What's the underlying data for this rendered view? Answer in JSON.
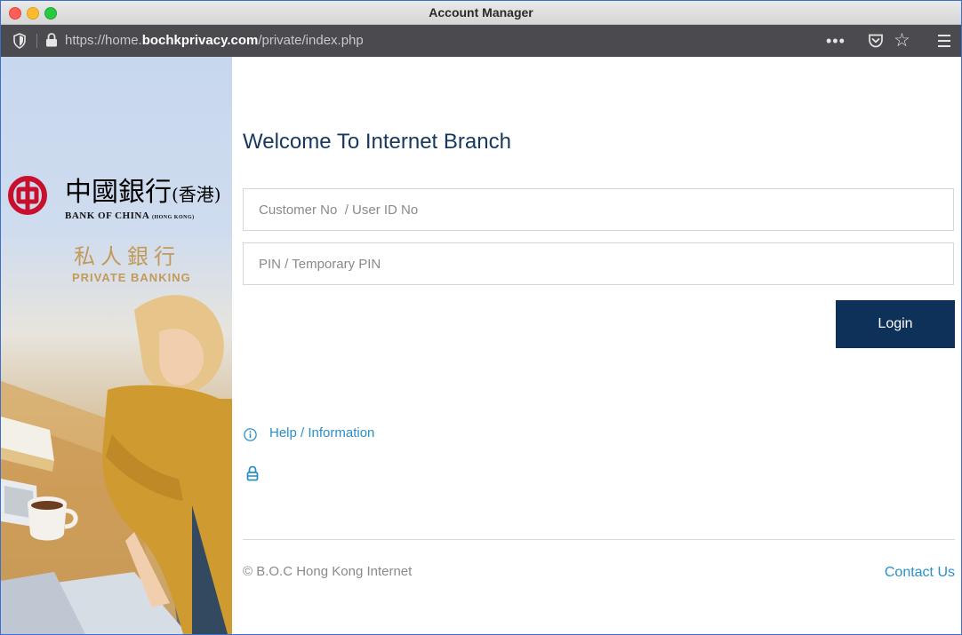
{
  "window": {
    "title": "Account Manager"
  },
  "browser": {
    "url_prefix": "https://home.",
    "url_host": "bochkprivacy.com",
    "url_path": "/private/index.php",
    "more_label": "•••",
    "star_label": "☆"
  },
  "brand": {
    "cn_name": "中國銀行",
    "cn_region": "(香港)",
    "en_name": "BANK OF CHINA",
    "en_region": "(HONG KONG)",
    "pb_cn": "私人銀行",
    "pb_en": "PRIVATE BANKING"
  },
  "form": {
    "heading": "Welcome To Internet Branch",
    "user_placeholder": "Customer No  / User ID No",
    "pin_placeholder": "PIN / Temporary PIN",
    "login_label": "Login"
  },
  "links": {
    "help": "Help / Information"
  },
  "footer": {
    "copyright": "© B.O.C Hong Kong Internet",
    "contact": "Contact Us"
  },
  "colors": {
    "primary": "#0d3158",
    "heading": "#17375e",
    "link": "#2a8fc8",
    "gold": "#c29a5a",
    "logo_red": "#c8102e"
  }
}
